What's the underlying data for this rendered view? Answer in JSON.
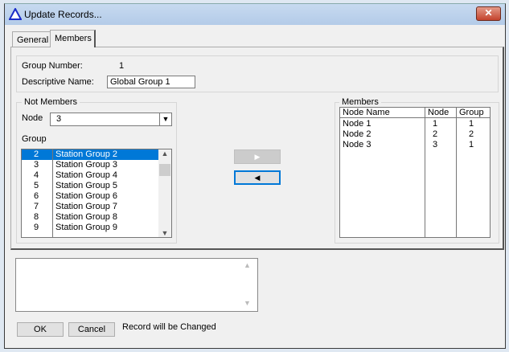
{
  "window": {
    "title": "Update Records...",
    "close_label": "✕"
  },
  "tabs": [
    {
      "label": "General"
    },
    {
      "label": "Members"
    }
  ],
  "info": {
    "group_number_label": "Group Number:",
    "group_number_value": "1",
    "descriptive_name_label": "Descriptive Name:",
    "descriptive_name_value": "Global Group 1"
  },
  "not_members": {
    "legend": "Not Members",
    "node_label": "Node",
    "node_value": "3",
    "group_label": "Group",
    "groups": [
      {
        "num": "2",
        "name": "Station Group 2"
      },
      {
        "num": "3",
        "name": "Station Group 3"
      },
      {
        "num": "4",
        "name": "Station Group 4"
      },
      {
        "num": "5",
        "name": "Station Group 5"
      },
      {
        "num": "6",
        "name": "Station Group 6"
      },
      {
        "num": "7",
        "name": "Station Group 7"
      },
      {
        "num": "8",
        "name": "Station Group 8"
      },
      {
        "num": "9",
        "name": "Station Group 9"
      }
    ]
  },
  "members": {
    "legend": "Members",
    "headers": [
      "Node Name",
      "Node",
      "Group"
    ],
    "rows": [
      [
        "Node 1",
        "1",
        "1"
      ],
      [
        "Node 2",
        "2",
        "2"
      ],
      [
        "Node 3",
        "3",
        "1"
      ]
    ]
  },
  "footer": {
    "ok_label": "OK",
    "cancel_label": "Cancel",
    "status": "Record will be Changed",
    "notes_value": ""
  }
}
